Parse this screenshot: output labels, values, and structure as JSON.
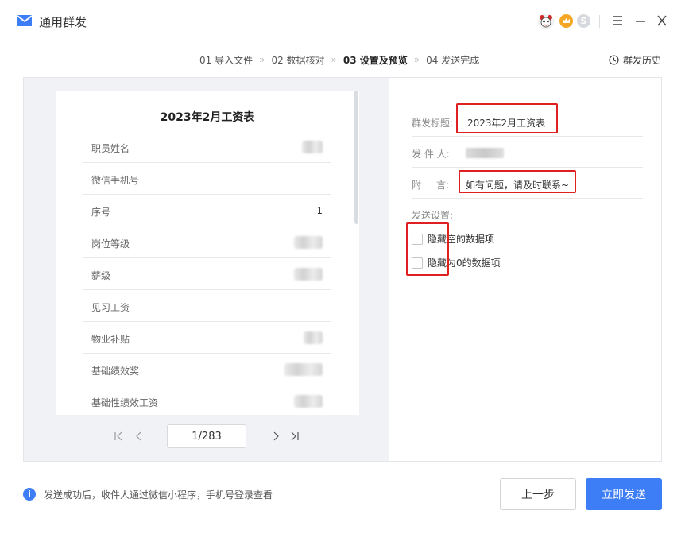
{
  "app": {
    "title": "通用群发",
    "icon": "envelope-icon",
    "accent": "#3d7df5"
  },
  "titlebar": {
    "avatar_icon": "panda-avatar-icon",
    "vip_icon": "crown-badge-icon",
    "coin_icon": "coin-icon",
    "coin_label": "S",
    "menu_icon": "hamburger-menu-icon",
    "minimize_icon": "minimize-icon",
    "close_icon": "close-icon"
  },
  "steps": [
    {
      "label": "01 导入文件",
      "active": false
    },
    {
      "label": "02 数据核对",
      "active": false
    },
    {
      "label": "03 设置及预览",
      "active": true
    },
    {
      "label": "04 发送完成",
      "active": false
    }
  ],
  "step_separator": "»",
  "history": {
    "label": "群发历史",
    "icon": "clock-icon"
  },
  "preview": {
    "title": "2023年2月工资表",
    "rows": [
      {
        "label": "职员姓名",
        "value": ""
      },
      {
        "label": "微信手机号",
        "value": ""
      },
      {
        "label": "序号",
        "value": "1"
      },
      {
        "label": "岗位等级",
        "value": ""
      },
      {
        "label": "薪级",
        "value": ""
      },
      {
        "label": "见习工资",
        "value": ""
      },
      {
        "label": "物业补贴",
        "value": ""
      },
      {
        "label": "基础绩效奖",
        "value": ""
      },
      {
        "label": "基础性绩效工资",
        "value": ""
      }
    ],
    "pager": {
      "current": "1/283"
    }
  },
  "settings": {
    "subject_label": "群发标题:",
    "subject_value": "2023年2月工资表",
    "sender_label": "发 件 人:",
    "note_label": "附     言:",
    "note_value": "如有问题，请及时联系~",
    "send_settings_label": "发送设置:",
    "options": [
      {
        "label": "隐藏空的数据项",
        "checked": false
      },
      {
        "label": "隐藏为0的数据项",
        "checked": false
      }
    ]
  },
  "footer": {
    "info": "发送成功后，收件人通过微信小程序，手机号登录查看",
    "prev_button": "上一步",
    "send_button": "立即发送"
  }
}
